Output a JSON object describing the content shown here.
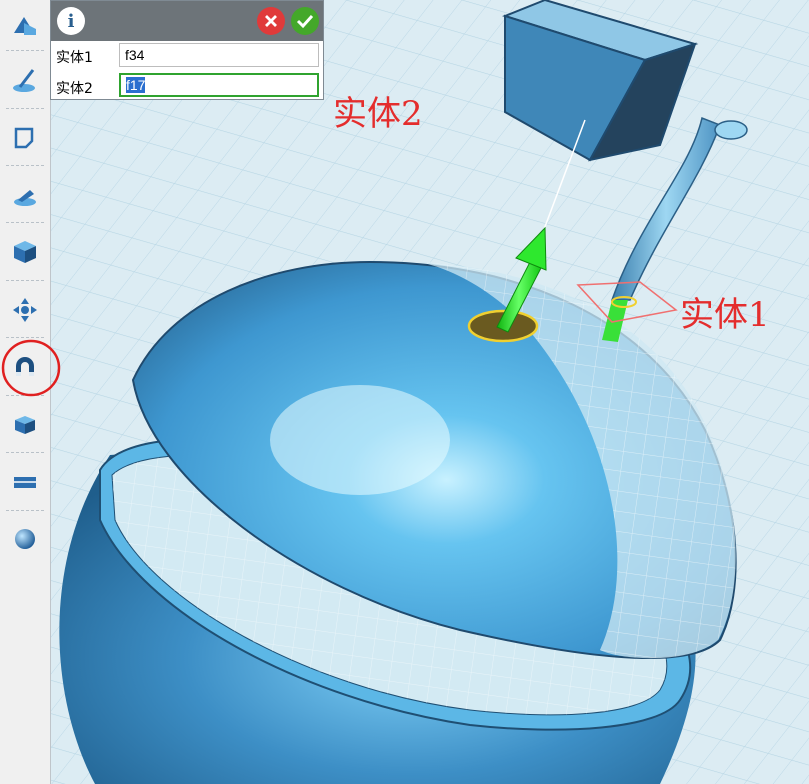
{
  "dialog": {
    "info_icon": "info-icon",
    "cancel_icon": "cancel-icon",
    "confirm_icon": "confirm-icon",
    "row1": {
      "label": "实体1",
      "value": "f34"
    },
    "row2": {
      "label": "实体2",
      "value": "f17"
    }
  },
  "annotations": {
    "solid2": "实体2",
    "solid1": "实体1"
  },
  "toolbar": {
    "items": [
      "basic-shape-icon",
      "sketch-pen-icon",
      "sketch-edit-icon",
      "feature-icon",
      "special-function-icon",
      "move-icon",
      "snap-magnet-icon",
      "combine-icon",
      "measure-icon",
      "material-sphere-icon"
    ],
    "highlighted": "snap-magnet-icon"
  },
  "colors": {
    "annotation": "#e42d2d",
    "highlight_circle": "#e02020",
    "cancel": "#e03a3a",
    "confirm": "#44a82a",
    "model": "#4aa3d8",
    "axis": "#24e024"
  }
}
